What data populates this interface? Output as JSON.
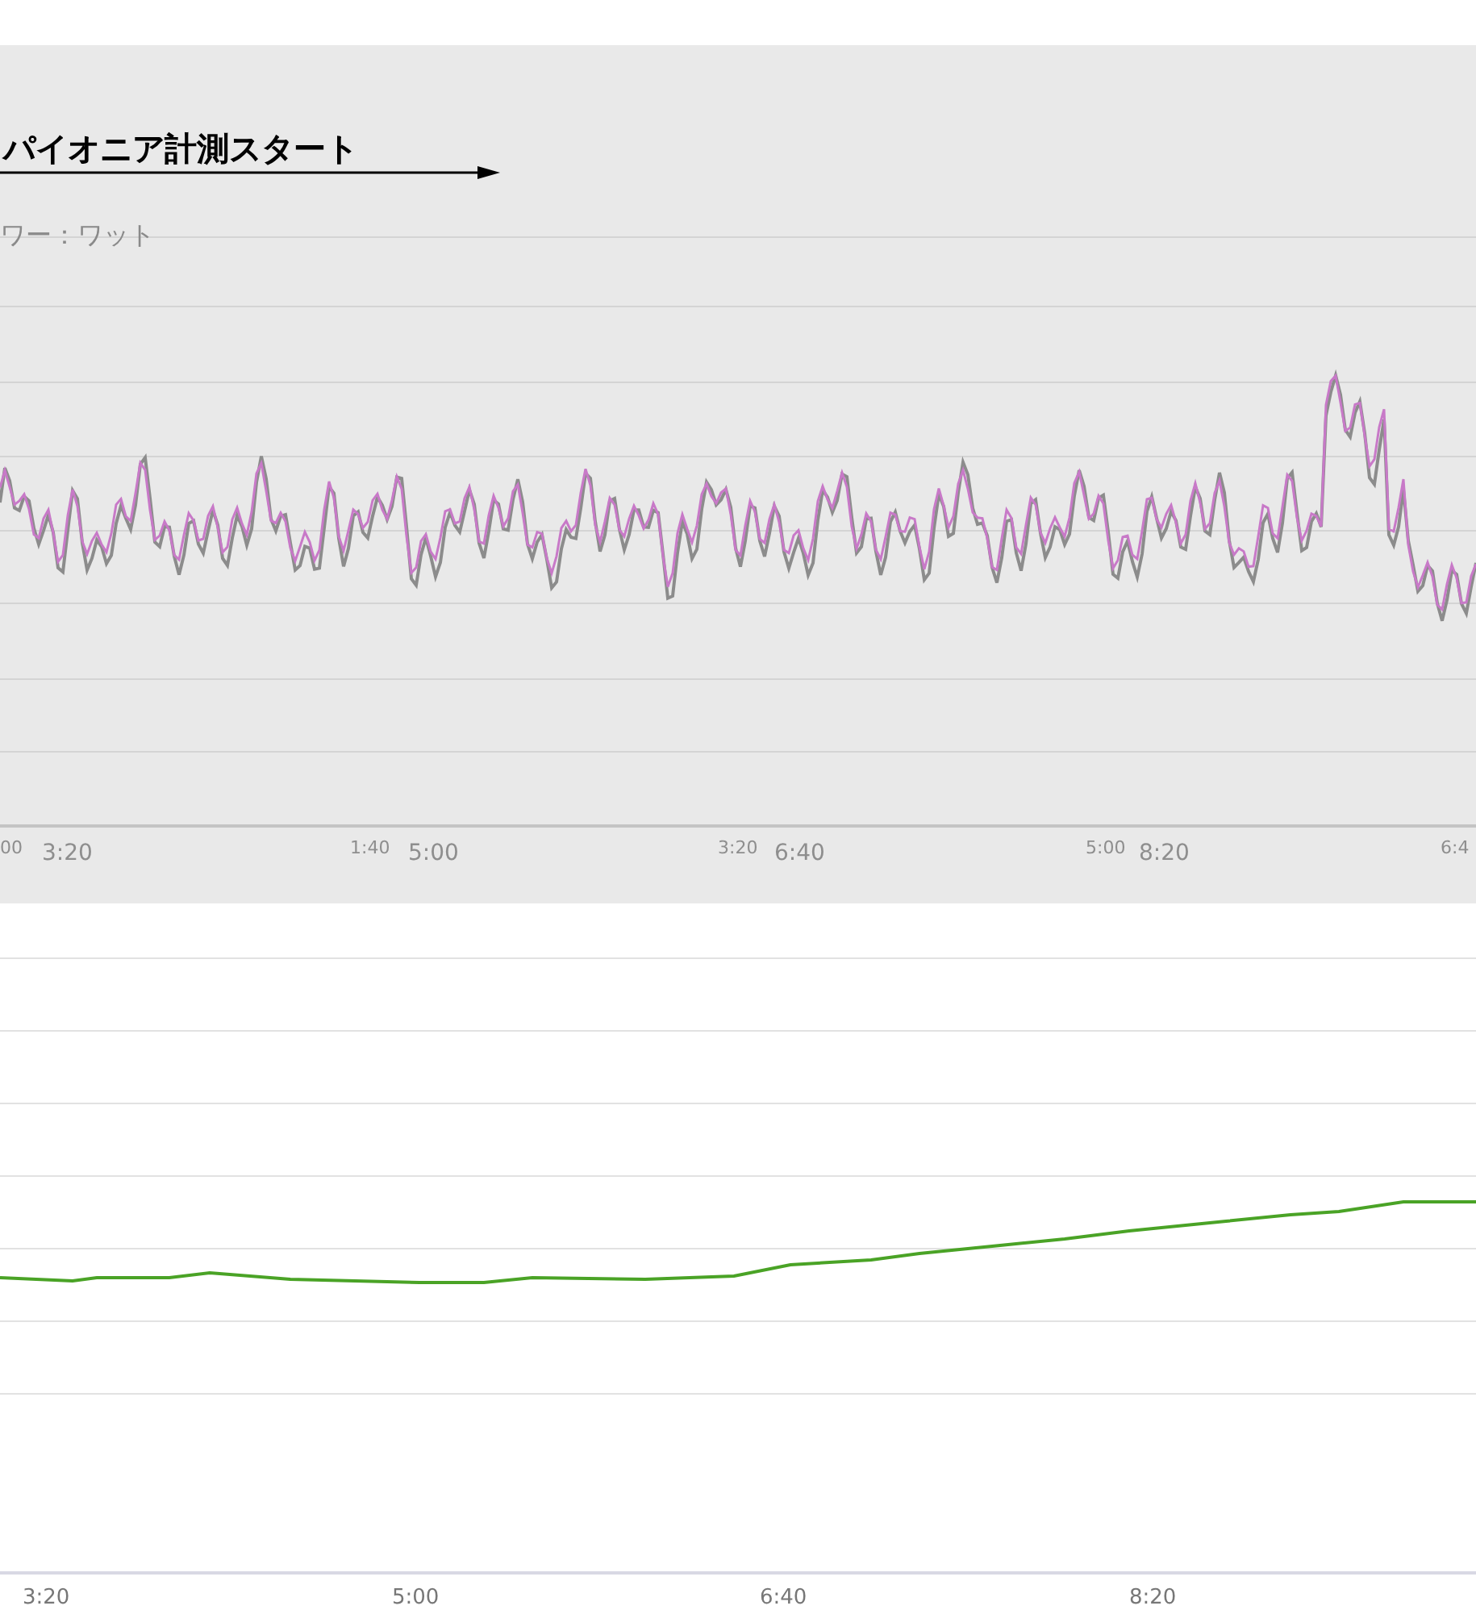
{
  "power_chart": {
    "annotation": "パイオニア計測スタート",
    "axis_label": "ワー：ワット",
    "x_labels": [
      {
        "text": "00",
        "kind": "secondary"
      },
      {
        "text": "3:20",
        "kind": "primary"
      },
      {
        "text": "1:40",
        "kind": "secondary"
      },
      {
        "text": "5:00",
        "kind": "primary"
      },
      {
        "text": "3:20",
        "kind": "secondary"
      },
      {
        "text": "6:40",
        "kind": "primary"
      },
      {
        "text": "5:00",
        "kind": "secondary"
      },
      {
        "text": "8:20",
        "kind": "primary"
      },
      {
        "text": "6:4",
        "kind": "secondary"
      }
    ]
  },
  "speed_chart": {
    "x_labels": [
      "3:20",
      "5:00",
      "6:40",
      "8:20"
    ]
  }
}
